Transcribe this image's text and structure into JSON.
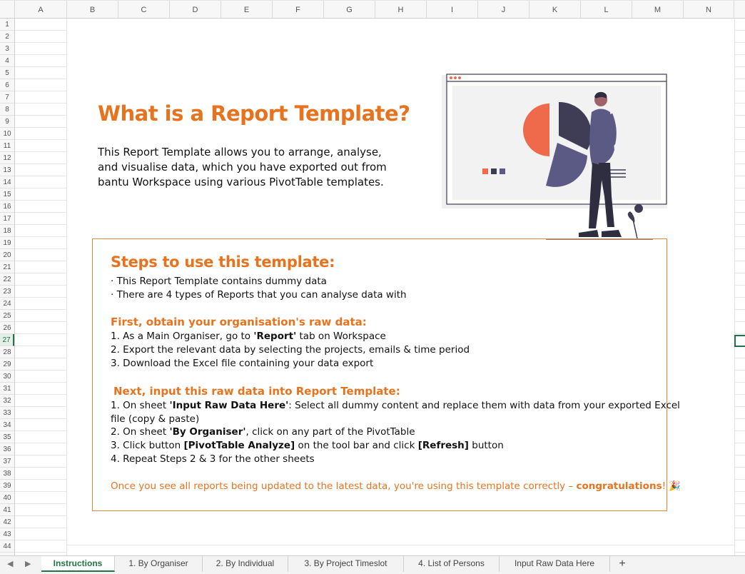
{
  "columns": [
    "A",
    "B",
    "C",
    "D",
    "E",
    "F",
    "G",
    "H",
    "I",
    "J",
    "K",
    "L",
    "M",
    "N"
  ],
  "rows": [
    "1",
    "2",
    "3",
    "4",
    "5",
    "6",
    "7",
    "8",
    "9",
    "10",
    "11",
    "12",
    "13",
    "14",
    "15",
    "16",
    "17",
    "18",
    "19",
    "20",
    "21",
    "22",
    "23",
    "24",
    "25",
    "26",
    "27",
    "28",
    "29",
    "30",
    "31",
    "32",
    "33",
    "34",
    "35",
    "36",
    "37",
    "38",
    "39",
    "40",
    "41",
    "42",
    "43",
    "44"
  ],
  "selected_row": "27",
  "heading": "What is a Report Template?",
  "intro_lines": [
    "This Report Template allows you to arrange, analyse,",
    "and visualise data, which you have exported out from",
    "bantu Workspace using various PivotTable templates."
  ],
  "steps": {
    "title": "Steps to use this template:",
    "bullets": [
      "· This Report Template contains dummy data",
      "· There are 4 types of Reports that you can analyse data with"
    ],
    "first_title": "First, obtain your organisation's raw data:",
    "first": {
      "s1_a": "1. As a Main Organiser, go to ",
      "s1_b": "'Report'",
      "s1_c": " tab on Workspace",
      "s2": "2. Export the relevant data by selecting the projects, emails & time period",
      "s3": "3. Download the Excel file containing your data export"
    },
    "next_title": "Next, input this raw data into Report Template:",
    "next": {
      "s1_a": "1. On sheet ",
      "s1_b": "'Input Raw Data Here'",
      "s1_c": ": Select all dummy content and replace them with data from your exported Excel",
      "s1_d": "file (copy & paste)",
      "s2_a": "2. On sheet ",
      "s2_b": "'By Organiser'",
      "s2_c": ", click on any part of the PivotTable",
      "s3_a": "3. Click button ",
      "s3_b": "[PivotTable Analyze]",
      "s3_c": " on the tool bar and click ",
      "s3_d": "[Refresh]",
      "s3_e": " button",
      "s4": "4. Repeat Steps 2 & 3 for the other sheets"
    },
    "footer_a": "Once you see all reports being updated to the latest data, you're using this template correctly – ",
    "footer_b": "congratulations",
    "footer_c": "! 🎉"
  },
  "tabs": [
    "Instructions",
    "1. By Organiser",
    "2. By Individual",
    "3. By Project Timeslot",
    "4. List of Persons",
    "Input Raw Data Here"
  ],
  "active_tab": "Instructions",
  "plus_label": "+",
  "nav_prev": "◀",
  "nav_next": "▶",
  "colors": {
    "accent": "#e8731e",
    "excel_green": "#217346"
  },
  "icons": [
    "chevron-left-icon",
    "chevron-right-icon",
    "add-sheet-icon"
  ]
}
